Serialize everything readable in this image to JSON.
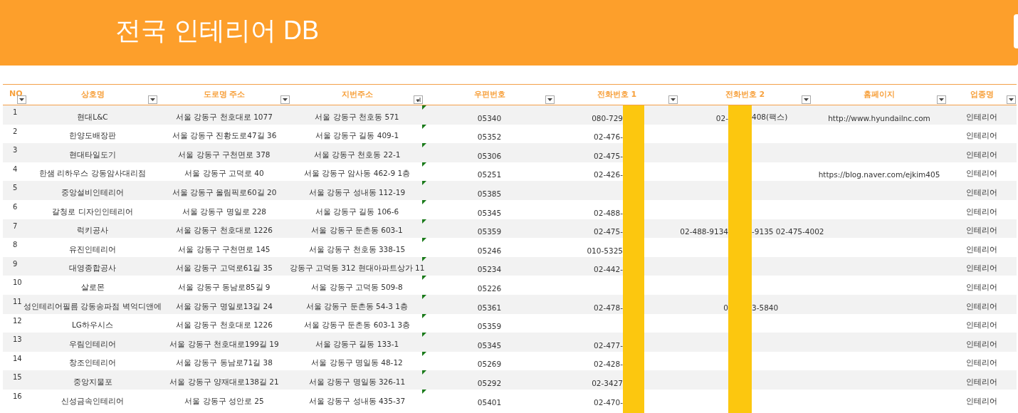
{
  "title": "전국 인테리어 DB",
  "columns": [
    {
      "label": "NO",
      "sorted": false
    },
    {
      "label": "상호명",
      "sorted": false
    },
    {
      "label": "도로명 주소",
      "sorted": false
    },
    {
      "label": "지번주소",
      "sorted": true
    },
    {
      "label": "우편번호",
      "sorted": false
    },
    {
      "label": "전화번호 1",
      "sorted": false
    },
    {
      "label": "전화번호 2",
      "sorted": false
    },
    {
      "label": "홈페이지",
      "sorted": false
    },
    {
      "label": "업종명",
      "sorted": false
    }
  ],
  "rows": [
    {
      "no": "1",
      "name": "현대L&C",
      "road": "서울 강동구 천호대로 1077",
      "jibun": "서울 강동구 천호동 571",
      "zip": "05340",
      "phone1": "080-729",
      "phone2_before": "02-",
      "phone2_after": "408(팩스)",
      "homepage": "http://www.hyundailnc.com",
      "type": "인테리어"
    },
    {
      "no": "2",
      "name": "한양도배장판",
      "road": "서울 강동구 진황도로47길 36",
      "jibun": "서울 강동구 길동 409-1",
      "zip": "05352",
      "phone1": "02-476-",
      "type": "인테리어"
    },
    {
      "no": "3",
      "name": "현대타일도기",
      "road": "서울 강동구 구천면로 378",
      "jibun": "서울 강동구 천호동 22-1",
      "zip": "05306",
      "phone1": "02-475-",
      "type": "인테리어"
    },
    {
      "no": "4",
      "name": "한샘 리하우스 강동암사대리점",
      "road": "서울 강동구 고덕로 40",
      "jibun": "서울 강동구 암사동 462-9 1층",
      "zip": "05251",
      "phone1": "02-426-",
      "homepage": "https://blog.naver.com/ejkim405",
      "type": "인테리어"
    },
    {
      "no": "5",
      "name": "중앙설비인테리어",
      "road": "서울 강동구 올림픽로60길 20",
      "jibun": "서울 강동구 성내동 112-19",
      "zip": "05385",
      "type": "인테리어"
    },
    {
      "no": "6",
      "name": "갈청로 디자인인테리어",
      "road": "서울 강동구 명일로 228",
      "jibun": "서울 강동구 길동 106-6",
      "zip": "05345",
      "phone1": "02-488-",
      "type": "인테리어"
    },
    {
      "no": "7",
      "name": "럭키공사",
      "road": "서울 강동구 천호대로 1226",
      "jibun": "서울 강동구 둔촌동 603-1",
      "zip": "05359",
      "phone1": "02-475-",
      "phone2_before": "02-488-9134",
      "phone2_after": "-9135 02-475-4002",
      "type": "인테리어"
    },
    {
      "no": "8",
      "name": "유진인테리어",
      "road": "서울 강동구 구천면로 145",
      "jibun": "서울 강동구 천호동 338-15",
      "zip": "05246",
      "phone1": "010-5325",
      "type": "인테리어"
    },
    {
      "no": "9",
      "name": "대영종합공사",
      "road": "서울 강동구 고덕로61길 35",
      "jibun": "강동구 고덕동 312 현대아파트상가 11",
      "zip": "05234",
      "phone1": "02-442-",
      "type": "인테리어"
    },
    {
      "no": "10",
      "name": "살로몬",
      "road": "서울 강동구 동남로85길 9",
      "jibun": "서울 강동구 고덕동 509-8",
      "zip": "05226",
      "type": "인테리어"
    },
    {
      "no": "11",
      "name": "성인테리어필름 강동송파점 벽억디앤에",
      "road": "서울 강동구 명일로13길 24",
      "jibun": "서울 강동구 둔촌동 54-3 1층",
      "zip": "05361",
      "phone1": "02-478-",
      "phone2_before": "0",
      "phone2_after": "3-5840",
      "type": "인테리어"
    },
    {
      "no": "12",
      "name": "LG하우시스",
      "road": "서울 강동구 천호대로 1226",
      "jibun": "서울 강동구 둔촌동 603-1 3층",
      "zip": "05359",
      "type": "인테리어"
    },
    {
      "no": "13",
      "name": "우림인테리어",
      "road": "서울 강동구 천호대로199길 19",
      "jibun": "서울 강동구 길동 133-1",
      "zip": "05345",
      "phone1": "02-477-",
      "type": "인테리어"
    },
    {
      "no": "14",
      "name": "창조인테리어",
      "road": "서울 강동구 동남로71길 38",
      "jibun": "서울 강동구 명일동 48-12",
      "zip": "05269",
      "phone1": "02-428-",
      "type": "인테리어"
    },
    {
      "no": "15",
      "name": "중앙지물포",
      "road": "서울 강동구 양재대로138길 21",
      "jibun": "서울 강동구 명일동 326-11",
      "zip": "05292",
      "phone1": "02-3427",
      "type": "인테리어"
    },
    {
      "no": "16",
      "name": "신성금속인테리어",
      "road": "서울 강동구 성안로 25",
      "jibun": "서울 강동구 성내동 435-37",
      "zip": "05401",
      "phone1": "02-470-",
      "type": "인테리어"
    }
  ]
}
